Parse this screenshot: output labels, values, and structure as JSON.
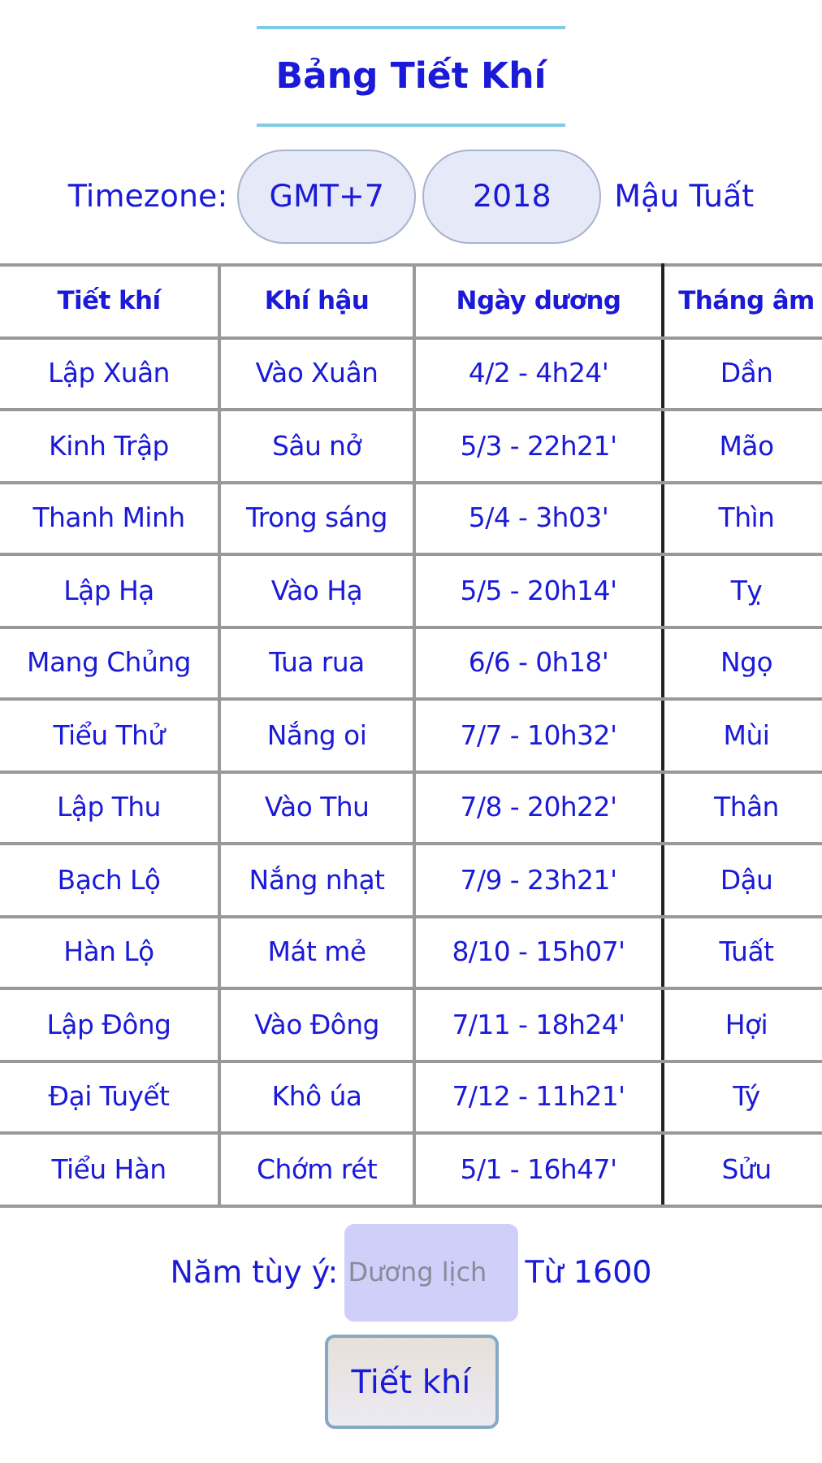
{
  "title": "Bảng Tiết Khí",
  "timezone": {
    "label": "Timezone:",
    "zone": "GMT+7",
    "year": "2018",
    "year_name": "Mậu Tuất"
  },
  "table": {
    "columns": [
      "Tiết khí",
      "Khí hậu",
      "Ngày dương",
      "Tháng âm"
    ],
    "rows": [
      [
        "Lập Xuân",
        "Vào Xuân",
        "4/2 - 4h24'",
        "Dần"
      ],
      [
        "Kinh Trập",
        "Sâu nở",
        "5/3 - 22h21'",
        "Mão"
      ],
      [
        "Thanh Minh",
        "Trong sáng",
        "5/4 - 3h03'",
        "Thìn"
      ],
      [
        "Lập Hạ",
        "Vào Hạ",
        "5/5 - 20h14'",
        "Tỵ"
      ],
      [
        "Mang Chủng",
        "Tua rua",
        "6/6 - 0h18'",
        "Ngọ"
      ],
      [
        "Tiểu Thử",
        "Nắng oi",
        "7/7 - 10h32'",
        "Mùi"
      ],
      [
        "Lập Thu",
        "Vào Thu",
        "7/8 - 20h22'",
        "Thân"
      ],
      [
        "Bạch Lộ",
        "Nắng nhạt",
        "7/9 - 23h21'",
        "Dậu"
      ],
      [
        "Hàn Lộ",
        "Mát mẻ",
        "8/10 - 15h07'",
        "Tuất"
      ],
      [
        "Lập Đông",
        "Vào Đông",
        "7/11 - 18h24'",
        "Hợi"
      ],
      [
        "Đại Tuyết",
        "Khô úa",
        "7/12 - 11h21'",
        "Tý"
      ],
      [
        "Tiểu Hàn",
        "Chớm rét",
        "5/1 - 16h47'",
        "Sửu"
      ]
    ]
  },
  "custom_year": {
    "label": "Năm tùy ý:",
    "placeholder": "Dương lịch",
    "note": "Từ 1600"
  },
  "button": "Tiết khí"
}
